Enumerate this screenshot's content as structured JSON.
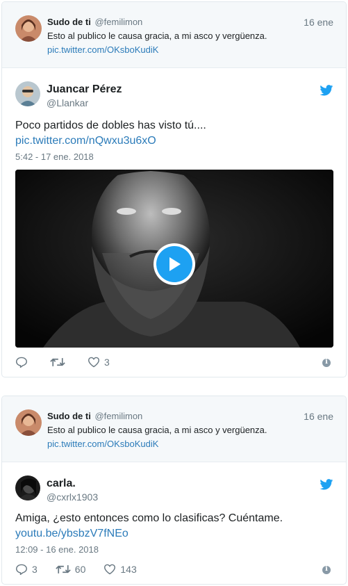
{
  "tweet1": {
    "reply_to": {
      "name": "Sudo de ti",
      "handle": "@femilimon",
      "date": "16 ene",
      "text": "Esto al publico le causa gracia, a mi asco y vergüenza.",
      "link": "pic.twitter.com/OKsboKudiK"
    },
    "author_name": "Juancar Pérez",
    "author_handle": "@Llankar",
    "text": "Poco partidos de dobles has visto tú....",
    "link": "pic.twitter.com/nQwxu3u6xO",
    "timestamp": "5:42 - 17 ene. 2018",
    "actions": {
      "replies": "",
      "retweets": "",
      "likes": "3"
    }
  },
  "tweet2": {
    "reply_to": {
      "name": "Sudo de ti",
      "handle": "@femilimon",
      "date": "16 ene",
      "text": "Esto al publico le causa gracia, a mi asco y vergüenza.",
      "link": "pic.twitter.com/OKsboKudiK"
    },
    "author_name": "carla.",
    "author_handle": "@cxrlx1903",
    "text": "Amiga, ¿esto entonces como lo clasificas? Cuéntame.",
    "link": "youtu.be/ybsbzV7fNEo",
    "timestamp": "12:09 - 16 ene. 2018",
    "actions": {
      "replies": "3",
      "retweets": "60",
      "likes": "143"
    }
  },
  "colors": {
    "twitter_blue": "#1da1f2",
    "link": "#2b7bb9",
    "muted": "#697882"
  }
}
